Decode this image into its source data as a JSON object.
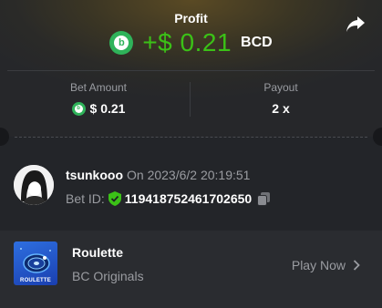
{
  "profit": {
    "label": "Profit",
    "value": "+$ 0.21",
    "currency": "BCD",
    "coin_glyph": "b"
  },
  "bet": {
    "amount_label": "Bet Amount",
    "amount_value": "$ 0.21",
    "payout_label": "Payout",
    "payout_value": "2 x"
  },
  "user": {
    "name": "tsunkooo",
    "date": "On 2023/6/2 20:19:51",
    "bet_id_label": "Bet ID:",
    "bet_id": "119418752461702650"
  },
  "game": {
    "title": "Roulette",
    "provider": "BC Originals",
    "thumb_label": "ROULETTE",
    "play_label": "Play Now"
  },
  "colors": {
    "profit_green": "#3bc117",
    "coin_green": "#2fb35a",
    "muted_text": "#9a9ca1",
    "panel_bg": "#2a2c30"
  },
  "icons": [
    "share-icon",
    "coin-icon",
    "shield-check-icon",
    "copy-icon",
    "chevron-right-icon"
  ]
}
